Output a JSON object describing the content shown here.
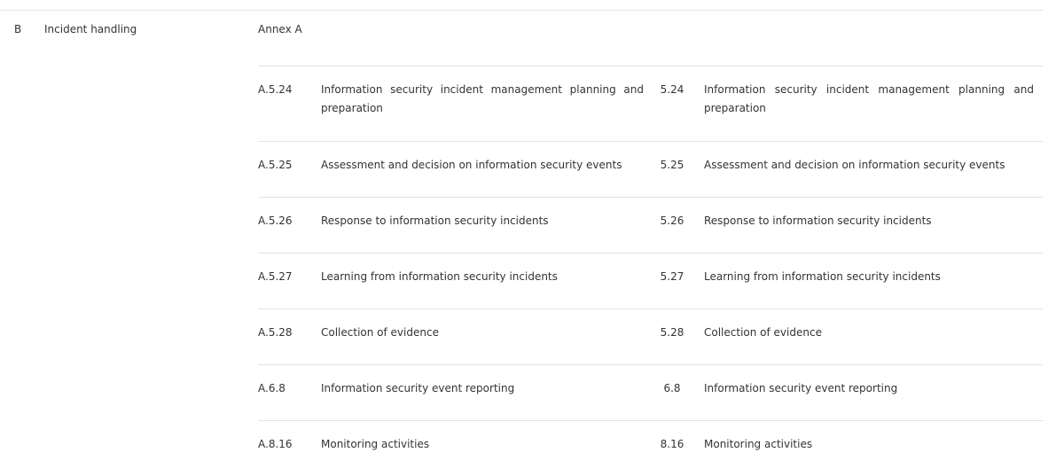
{
  "section": {
    "id": "B",
    "title": "Incident handling",
    "annex_label": "Annex A"
  },
  "rows": [
    {
      "annex_code": "A.5.24",
      "annex_desc": "Information security incident management planning and preparation",
      "code": "5.24",
      "desc": "Information security incident management planning and preparation"
    },
    {
      "annex_code": "A.5.25",
      "annex_desc": "Assessment and decision on information security events",
      "code": "5.25",
      "desc": "Assessment and decision on information security events"
    },
    {
      "annex_code": "A.5.26",
      "annex_desc": "Response to information security incidents",
      "code": "5.26",
      "desc": "Response to information security incidents"
    },
    {
      "annex_code": "A.5.27",
      "annex_desc": "Learning from information security incidents",
      "code": "5.27",
      "desc": "Learning from information security incidents"
    },
    {
      "annex_code": "A.5.28",
      "annex_desc": "Collection of evidence",
      "code": "5.28",
      "desc": "Collection of evidence"
    },
    {
      "annex_code": "A.6.8",
      "annex_desc": "Information security event reporting",
      "code": "6.8",
      "desc": "Information security event reporting"
    },
    {
      "annex_code": "A.8.16",
      "annex_desc": "Monitoring activities",
      "code": "8.16",
      "desc": "Monitoring activities"
    }
  ]
}
